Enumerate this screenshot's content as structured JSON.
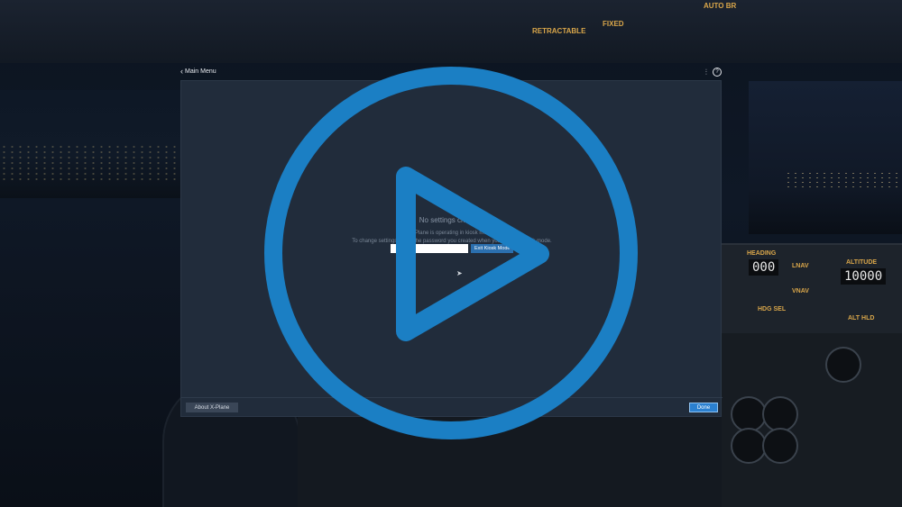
{
  "background": {
    "panel_labels": [
      "RETRACTABLE",
      "FIXED",
      "AUTO BR"
    ],
    "fcu": {
      "heading_label": "HEADING",
      "heading_value": "000",
      "altitude_label": "ALTITUDE",
      "altitude_value": "10000",
      "buttons": [
        "LNAV",
        "VNAV",
        "HDG SEL",
        "ALT HLD"
      ]
    }
  },
  "topbar": {
    "back_label": "Main Menu",
    "back_icon": "chevron-left-icon",
    "settings_icon": "sliders-icon",
    "help_icon": "help-icon"
  },
  "dialog": {
    "title": "No settings changes",
    "line1": "X-Plane is operating in kiosk mode.",
    "line2": "To change settings, enter the password you created when you enabled kiosk mode.",
    "password_value": "",
    "exit_button_label": "Exit Kiosk Mode",
    "about_button_label": "About X-Plane",
    "done_button_label": "Done"
  },
  "overlay": {
    "icon": "play-icon",
    "color": "#1b7fc4"
  },
  "colors": {
    "dialog_bg": "#212c3b",
    "accent": "#2b80d0"
  }
}
